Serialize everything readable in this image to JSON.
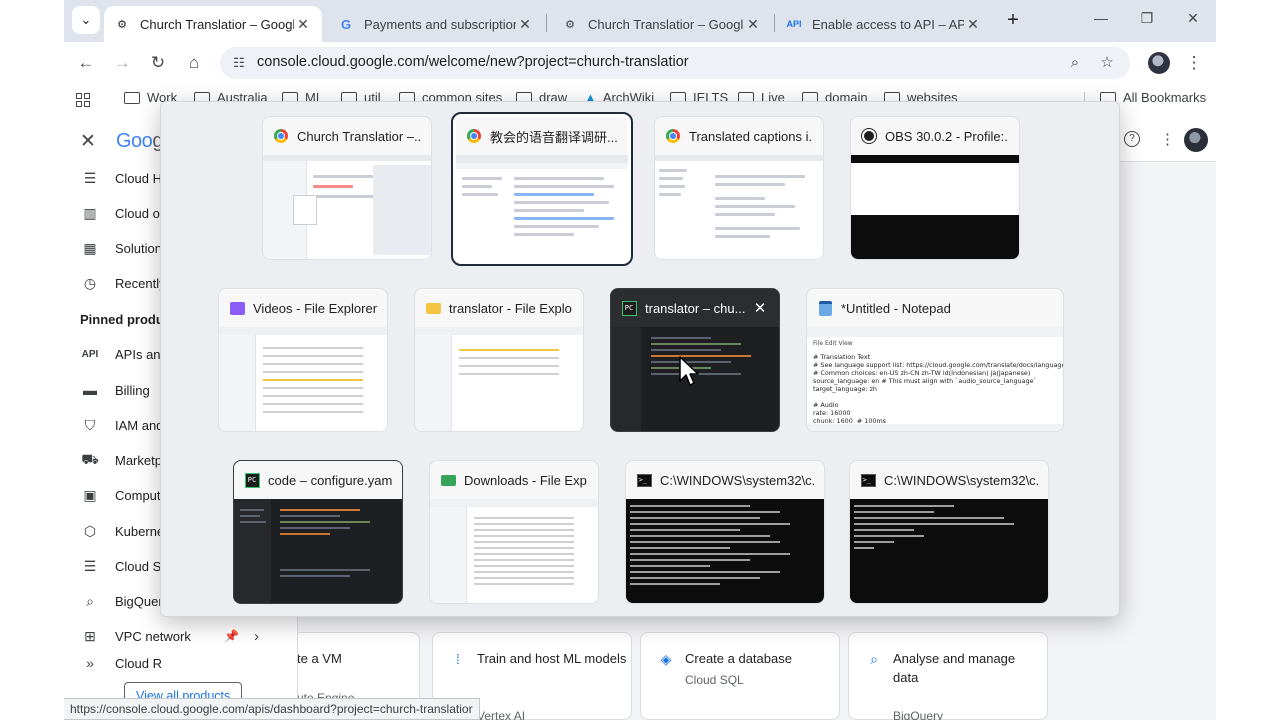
{
  "browser": {
    "tabs": [
      {
        "title": "Church Translatior – Google C",
        "active": true,
        "icon": "gear-favicon-icon"
      },
      {
        "title": "Payments and subscriptions",
        "active": false,
        "icon": "google-favicon-icon"
      },
      {
        "title": "Church Translatior – Google C",
        "active": false,
        "icon": "gear-favicon-icon"
      },
      {
        "title": "Enable access to API – APIs a",
        "active": false,
        "icon": "api-favicon-icon"
      }
    ],
    "api_favicon_text": "API",
    "url": "console.cloud.google.com/welcome/new?project=church-translatior",
    "bookmarks": [
      "Work",
      "Australia",
      "ML",
      "util",
      "common sites",
      "draw",
      "ArchWiki",
      "IELTS",
      "Live",
      "domain",
      "websites"
    ],
    "all_bookmarks_label": "All Bookmarks"
  },
  "console": {
    "logo_prefix": "Goo",
    "logo_suffix": "gle",
    "nav_items": [
      {
        "label": "Cloud Hu",
        "icon": "tune-icon"
      },
      {
        "label": "Cloud ove",
        "icon": "dashboard-icon"
      },
      {
        "label": "Solutions",
        "icon": "grid-icon"
      },
      {
        "label": "Recently",
        "icon": "clock-icon"
      }
    ],
    "pinned_label": "Pinned product",
    "pinned_items": [
      {
        "label": "APIs and",
        "icon": "api-icon"
      },
      {
        "label": "Billing",
        "icon": "billing-icon"
      },
      {
        "label": "IAM and",
        "icon": "shield-icon"
      },
      {
        "label": "Marketpl",
        "icon": "cart-icon"
      },
      {
        "label": "Compute",
        "icon": "chip-icon"
      },
      {
        "label": "Kubernet",
        "icon": "kubernetes-icon"
      },
      {
        "label": "Cloud Sto",
        "icon": "storage-icon"
      },
      {
        "label": "BigQuery",
        "icon": "bigquery-icon"
      },
      {
        "label": "VPC network",
        "icon": "network-icon"
      },
      {
        "label": "Cloud R",
        "icon": "run-icon"
      }
    ],
    "view_all_label": "View all products",
    "cards": [
      {
        "title": "te a VM",
        "subtitle": "ute Engine"
      },
      {
        "title": "Train and host ML models",
        "subtitle": "Vertex AI"
      },
      {
        "title": "Create a database",
        "subtitle": "Cloud SQL"
      },
      {
        "title": "Analyse and manage data",
        "subtitle": "BigQuery"
      }
    ],
    "status_url": "https://console.cloud.google.com/apis/dashboard?project=church-translatior"
  },
  "switcher": {
    "windows": [
      {
        "title": "Church Translatior –...",
        "app": "chrome",
        "selected": false
      },
      {
        "title": "教会的语音翻译调研...",
        "app": "chrome",
        "selected": true
      },
      {
        "title": "Translated captions i...",
        "app": "chrome",
        "selected": false
      },
      {
        "title": "OBS 30.0.2 - Profile:...",
        "app": "obs",
        "selected": false
      },
      {
        "title": "Videos - File Explorer",
        "app": "explorer-videos",
        "selected": false
      },
      {
        "title": "translator - File Explo...",
        "app": "explorer",
        "selected": false
      },
      {
        "title": "translator – chu...",
        "app": "pycharm",
        "selected": false,
        "hover": true
      },
      {
        "title": "*Untitled - Notepad",
        "app": "notepad",
        "selected": false
      },
      {
        "title": "code – configure.yaml",
        "app": "pycharm",
        "selected": false
      },
      {
        "title": "Downloads - File Exp...",
        "app": "explorer-downloads",
        "selected": false
      },
      {
        "title": "C:\\WINDOWS\\system32\\c...",
        "app": "cmd",
        "selected": false
      },
      {
        "title": "C:\\WINDOWS\\system32\\c...",
        "app": "cmd",
        "selected": false
      }
    ],
    "pycharm_icon_text": "PC",
    "notepad_preview": {
      "menu": "File   Edit   View",
      "text": "# Translation Text\n# See language support list: https://cloud.google.com/translate/docs/languages\n# Common choices: en-US zh-CN zh-TW id(Indonesian) ja(Japanese)\nsource_language: en # This must align with `audio_source_language`\ntarget_language: zh\n\n# Audio\nrate: 16000\nchunk: 1600  # 100ms"
    }
  }
}
